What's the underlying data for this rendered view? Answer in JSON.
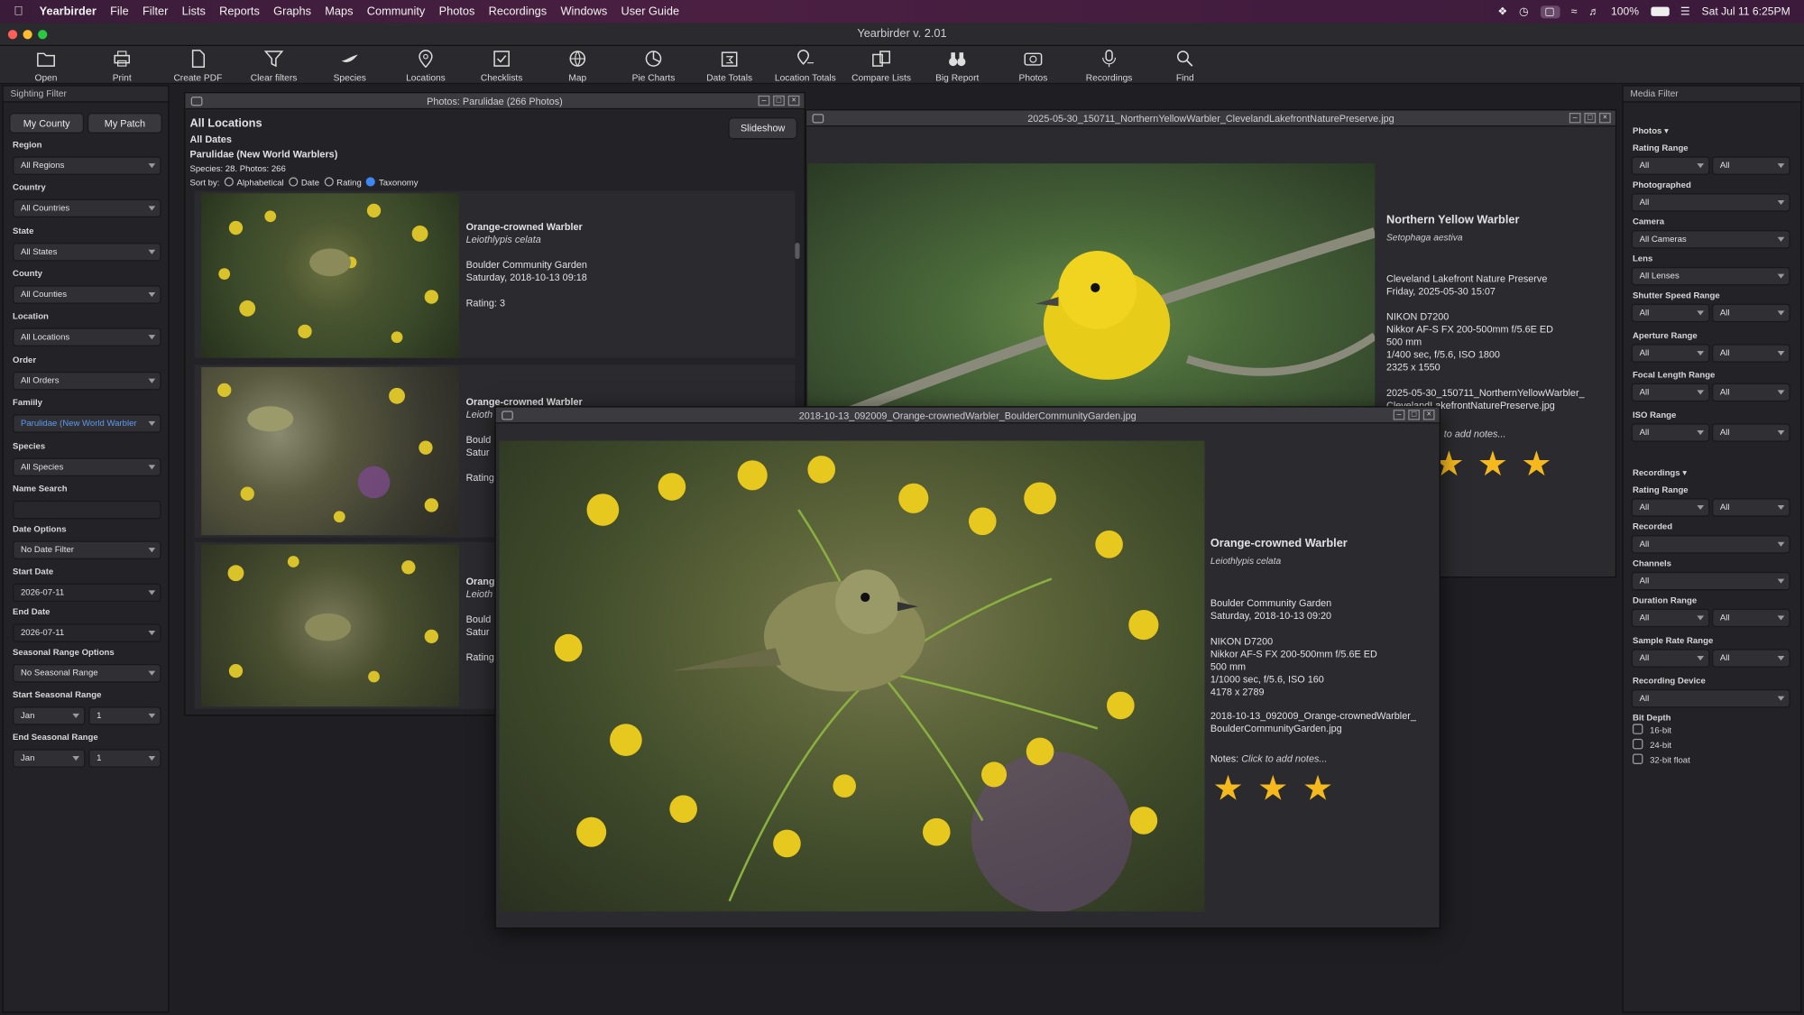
{
  "menubar": {
    "app": "Yearbirder",
    "items": [
      "File",
      "Filter",
      "Lists",
      "Reports",
      "Graphs",
      "Maps",
      "Community",
      "Photos",
      "Recordings",
      "Windows",
      "User Guide"
    ],
    "battery": "100%",
    "datetime": "Sat Jul 11  6:25PM"
  },
  "window": {
    "title": "Yearbirder v. 2.01"
  },
  "toolbar": [
    "Open",
    "Print",
    "Create PDF",
    "Clear filters",
    "Species",
    "Locations",
    "Checklists",
    "Map",
    "Pie Charts",
    "Date Totals",
    "Location Totals",
    "Compare Lists",
    "Big Report",
    "Photos",
    "Recordings",
    "Find"
  ],
  "sighting_filter": {
    "title": "Sighting Filter",
    "my_county": "My County",
    "my_patch": "My Patch",
    "region_label": "Region",
    "region": "All Regions",
    "country_label": "Country",
    "country": "All Countries",
    "state_label": "State",
    "state": "All States",
    "county_label": "County",
    "county": "All Counties",
    "location_label": "Location",
    "location": "All Locations",
    "order_label": "Order",
    "order": "All Orders",
    "family_label": "Famiily",
    "family": "Parulidae (New World Warbler",
    "species_label": "Species",
    "species": "All Species",
    "name_search_label": "Name Search",
    "name_search": "",
    "date_options_label": "Date Options",
    "date_options": "No Date Filter",
    "start_date_label": "Start Date",
    "start_date": "2026-07-11",
    "end_date_label": "End Date",
    "end_date": "2026-07-11",
    "seasonal_options_label": "Seasonal Range Options",
    "seasonal_options": "No Seasonal Range",
    "start_seasonal_label": "Start Seasonal Range",
    "start_month": "Jan",
    "start_day": "1",
    "end_seasonal_label": "End Seasonal Range",
    "end_month": "Jan",
    "end_day": "1"
  },
  "photos_window": {
    "title": "Photos: Parulidae (266 Photos)",
    "line1": "All Locations",
    "line2": "All Dates",
    "line3": "Parulidae (New World Warblers)",
    "line4": "Species: 28. Photos: 266",
    "sort_label": "Sort by:",
    "sort_options": [
      "Alphabetical",
      "Date",
      "Rating",
      "Taxonomy"
    ],
    "slideshow": "Slideshow",
    "entries": [
      {
        "name": "Orange-crowned Warbler",
        "sci": "Leiothlypis celata",
        "place": "Boulder Community Garden",
        "date": "Saturday, 2018-10-13 09:18",
        "rating": "Rating: 3"
      },
      {
        "name": "Orange-crowned Warbler",
        "sci": "Leioth",
        "place": "Bould",
        "date": "Satur",
        "rating": "Rating"
      },
      {
        "name": "Orang",
        "sci": "Leioth",
        "place": "Bould",
        "date": "Satur",
        "rating": "Rating"
      }
    ]
  },
  "yellow_window": {
    "title": "2025-05-30_150711_NorthernYellowWarbler_ClevelandLakefrontNaturePreserve.jpg",
    "name": "Northern Yellow Warbler",
    "sci": "Setophaga aestiva",
    "place": "Cleveland Lakefront Nature Preserve",
    "date": "Friday, 2025-05-30 15:07",
    "camera": "NIKON D7200",
    "lens": "Nikkor AF-S FX 200-500mm f/5.6E ED",
    "focal": "500 mm",
    "exposure": "1/400 sec, f/5.6, ISO 1800",
    "size": "2325 x 1550",
    "file1": "2025-05-30_150711_NorthernYellowWarbler_",
    "file2": "ClevelandLakefrontNaturePreserve.jpg",
    "notes": "to add notes..."
  },
  "ocw_window": {
    "title": "2018-10-13_092009_Orange-crownedWarbler_BoulderCommunityGarden.jpg",
    "name": "Orange-crowned Warbler",
    "sci": "Leiothlypis celata",
    "place": "Boulder Community Garden",
    "date": "Saturday, 2018-10-13 09:20",
    "camera": "NIKON D7200",
    "lens": "Nikkor AF-S FX 200-500mm f/5.6E ED",
    "focal": "500 mm",
    "exposure": "1/1000 sec, f/5.6, ISO 160",
    "size": "4178 x 2789",
    "file1": "2018-10-13_092009_Orange-crownedWarbler_",
    "file2": "BoulderCommunityGarden.jpg",
    "notes_label": "Notes:",
    "notes": "Click to add notes...",
    "rating": 3
  },
  "media_filter": {
    "title": "Media Filter",
    "photos_head": "Photos",
    "rating_range": "Rating Range",
    "photographed": "Photographed",
    "camera": "Camera",
    "camera_val": "All Cameras",
    "lens": "Lens",
    "lens_val": "All Lenses",
    "shutter": "Shutter Speed Range",
    "aperture": "Aperture Range",
    "focal": "Focal Length Range",
    "iso": "ISO Range",
    "recordings_head": "Recordings",
    "rec_rating": "Rating Range",
    "recorded": "Recorded",
    "channels": "Channels",
    "duration": "Duration Range",
    "sample_rate": "Sample Rate Range",
    "device": "Recording Device",
    "bit_depth": "Bit Depth",
    "bits": [
      "16-bit",
      "24-bit",
      "32-bit float"
    ],
    "all": "All"
  }
}
